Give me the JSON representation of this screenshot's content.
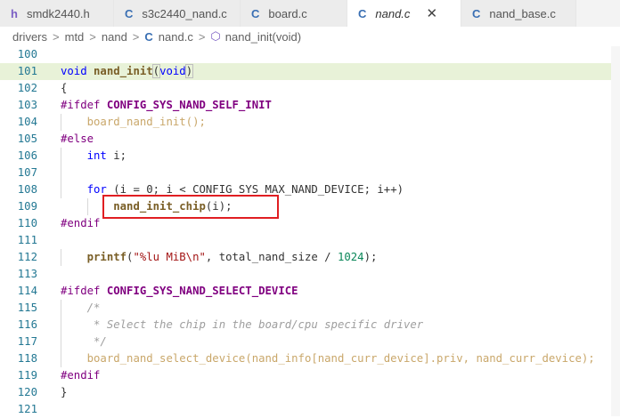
{
  "tabs": [
    {
      "icon": "h",
      "label": "smdk2440.h",
      "active": false
    },
    {
      "icon": "C",
      "label": "s3c2440_nand.c",
      "active": false
    },
    {
      "icon": "C",
      "label": "board.c",
      "active": false
    },
    {
      "icon": "C",
      "label": "nand.c",
      "active": true,
      "close": "✕"
    },
    {
      "icon": "C",
      "label": "nand_base.c",
      "active": false
    }
  ],
  "breadcrumb": [
    "drivers",
    "mtd",
    "nand",
    "nand.c",
    "nand_init(void)"
  ],
  "breadcrumb_file_icon": "C",
  "breadcrumb_symbol_icon": "⬡",
  "breadcrumb_separator": ">",
  "line_numbers": [
    "100",
    "101",
    "102",
    "103",
    "104",
    "105",
    "106",
    "107",
    "108",
    "109",
    "110",
    "111",
    "112",
    "113",
    "114",
    "115",
    "116",
    "117",
    "118",
    "119",
    "120",
    "121"
  ],
  "code": {
    "l101_kw": "void",
    "l101_fn": "nand_init",
    "l101_void": "void",
    "l102": "{",
    "l103_pp": "#ifdef",
    "l103_macro": "CONFIG_SYS_NAND_SELF_INIT",
    "l104": "board_nand_init();",
    "l105": "#else",
    "l106_kw": "int",
    "l106_rest": " i;",
    "l108_kw": "for",
    "l108_rest": " (i = 0; i < CONFIG_SYS_MAX_NAND_DEVICE; i++)",
    "l109_fn": "nand_init_chip",
    "l109_rest": "(i);",
    "l110": "#endif",
    "l112_fn": "printf",
    "l112_str": "\"%lu MiB\\n\"",
    "l112_rest": ", total_nand_size / ",
    "l112_num": "1024",
    "l112_end": ");",
    "l114_pp": "#ifdef",
    "l114_macro": "CONFIG_SYS_NAND_SELECT_DEVICE",
    "l115": "/*",
    "l116": " * Select the chip in the board/cpu specific driver",
    "l117": " */",
    "l118_fn": "board_nand_select_device",
    "l118_args": "(nand_info[nand_curr_device].priv, ",
    "l118_tail": "nand_curr_device);",
    "l119": "#endif",
    "l120": "}"
  },
  "colors": {
    "highlight_box": "#e01e22",
    "current_line": "#e8f2d8",
    "keyword": "#0000ff",
    "preprocessor": "#800080",
    "function": "#795e26"
  }
}
